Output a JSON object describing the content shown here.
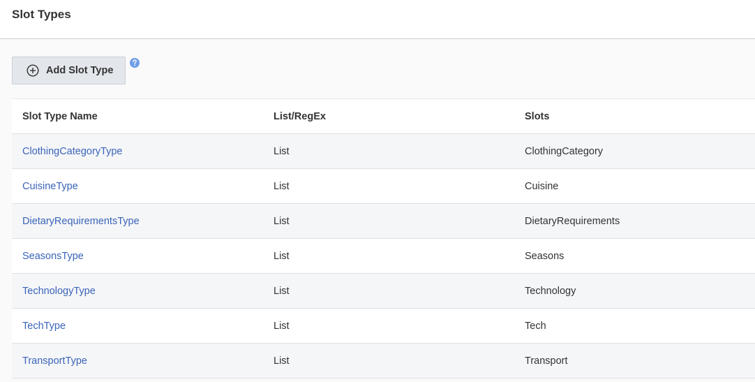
{
  "page": {
    "title": "Slot Types"
  },
  "toolbar": {
    "add_label": "Add Slot Type",
    "add_icon": "plus-circle-icon",
    "help_icon": "question-circle-icon"
  },
  "colors": {
    "link": "#3a64b8",
    "help": "#6f9de8",
    "button_bg": "#e3e7eb"
  },
  "table": {
    "headers": [
      "Slot Type Name",
      "List/RegEx",
      "Slots"
    ],
    "rows": [
      {
        "name": "ClothingCategoryType",
        "type": "List",
        "slots": "ClothingCategory"
      },
      {
        "name": "CuisineType",
        "type": "List",
        "slots": "Cuisine"
      },
      {
        "name": "DietaryRequirementsType",
        "type": "List",
        "slots": "DietaryRequirements"
      },
      {
        "name": "SeasonsType",
        "type": "List",
        "slots": "Seasons"
      },
      {
        "name": "TechnologyType",
        "type": "List",
        "slots": "Technology"
      },
      {
        "name": "TechType",
        "type": "List",
        "slots": "Tech"
      },
      {
        "name": "TransportType",
        "type": "List",
        "slots": "Transport"
      }
    ]
  }
}
